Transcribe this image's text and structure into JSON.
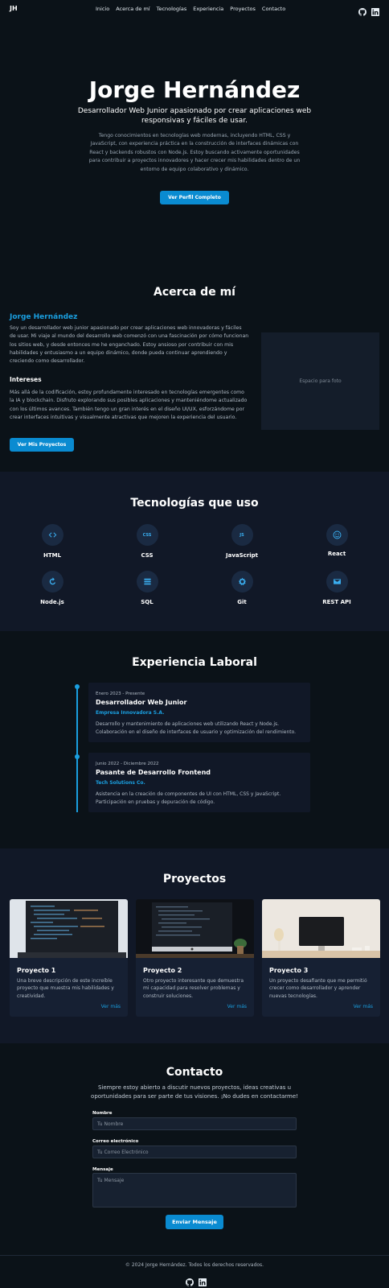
{
  "nav": {
    "logo": "JH",
    "items": [
      "Inicio",
      "Acerca de mí",
      "Tecnologías",
      "Experiencia",
      "Proyectos",
      "Contacto"
    ],
    "icons": [
      "github-icon",
      "linkedin-icon"
    ]
  },
  "hero": {
    "name": "Jorge Hernández",
    "subtitle": "Desarrollador Web Junior apasionado por crear aplicaciones web responsivas y fáciles de usar.",
    "description": "Tengo conocimientos en tecnologías web modernas, incluyendo HTML, CSS y JavaScript, con experiencia práctica en la construcción de interfaces dinámicas con React y backends robustos con Node.js. Estoy buscando activamente oportunidades para contribuir a proyectos innovadores y hacer crecer mis habilidades dentro de un entorno de equipo colaborativo y dinámico.",
    "button": "Ver Perfil Completo"
  },
  "about": {
    "title": "Acerca de mí",
    "name": "Jorge Hernández",
    "p1": "Soy un desarrollador web junior apasionado por crear aplicaciones web innovadoras y fáciles de usar. Mi viaje al mundo del desarrollo web comenzó con una fascinación por cómo funcionan los sitios web, y desde entonces me he enganchado. Estoy ansioso por contribuir con mis habilidades y entusiasmo a un equipo dinámico, donde pueda continuar aprendiendo y creciendo como desarrollador.",
    "interests_title": "Intereses",
    "p2": "Más allá de la codificación, estoy profundamente interesado en tecnologías emergentes como la IA y blockchain. Disfruto explorando sus posibles aplicaciones y manteniéndome actualizado con los últimos avances. También tengo un gran interés en el diseño UI/UX, esforzándome por crear interfaces intuitivas y visualmente atractivas que mejoren la experiencia del usuario.",
    "button": "Ver Mis Proyectos",
    "photo_placeholder": "Espacio para foto"
  },
  "tech": {
    "title": "Tecnologías que uso",
    "items": [
      {
        "label": "HTML",
        "icon": "code-icon",
        "glyph": "<>"
      },
      {
        "label": "CSS",
        "icon": "css-icon",
        "glyph": "CSS"
      },
      {
        "label": "JavaScript",
        "icon": "js-icon",
        "glyph": "JS"
      },
      {
        "label": "React",
        "icon": "react-icon",
        "glyph": ""
      },
      {
        "label": "Node.js",
        "icon": "node-icon",
        "glyph": ""
      },
      {
        "label": "SQL",
        "icon": "database-icon",
        "glyph": ""
      },
      {
        "label": "Git",
        "icon": "git-icon",
        "glyph": ""
      },
      {
        "label": "REST API",
        "icon": "mail-icon",
        "glyph": ""
      }
    ]
  },
  "experience": {
    "title": "Experiencia Laboral",
    "jobs": [
      {
        "date": "Enero 2023 - Presente",
        "role": "Desarrollador Web Junior",
        "company": "Empresa Innovadora S.A.",
        "desc": "Desarrollo y mantenimiento de aplicaciones web utilizando React y Node.js. Colaboración en el diseño de interfaces de usuario y optimización del rendimiento."
      },
      {
        "date": "Junio 2022 - Diciembre 2022",
        "role": "Pasante de Desarrollo Frontend",
        "company": "Tech Solutions Co.",
        "desc": "Asistencia en la creación de componentes de UI con HTML, CSS y JavaScript. Participación en pruebas y depuración de código."
      }
    ]
  },
  "projects": {
    "title": "Proyectos",
    "items": [
      {
        "title": "Proyecto 1",
        "desc": "Una breve descripción de este increíble proyecto que muestra mis habilidades y creatividad.",
        "link": "Ver más"
      },
      {
        "title": "Proyecto 2",
        "desc": "Otro proyecto interesante que demuestra mi capacidad para resolver problemas y construir soluciones.",
        "link": "Ver más"
      },
      {
        "title": "Proyecto 3",
        "desc": "Un proyecto desafiante que me permitió crecer como desarrollador y aprender nuevas tecnologías.",
        "link": "Ver más"
      }
    ]
  },
  "contact": {
    "title": "Contacto",
    "description": "Siempre estoy abierto a discutir nuevos proyectos, ideas creativas u oportunidades para ser parte de tus visiones. ¡No dudes en contactarme!",
    "name_label": "Nombre",
    "name_placeholder": "Tu Nombre",
    "email_label": "Correo electrónico",
    "email_placeholder": "Tu Correo Electrónico",
    "message_label": "Mensaje",
    "message_placeholder": "Tu Mensaje",
    "button": "Enviar Mensaje"
  },
  "footer": {
    "text": "© 2024 Jorge Hernández. Todos los derechos reservados."
  },
  "colors": {
    "background": "#0b1218",
    "accent": "#0a8bd1",
    "section_alt": "#111827"
  }
}
